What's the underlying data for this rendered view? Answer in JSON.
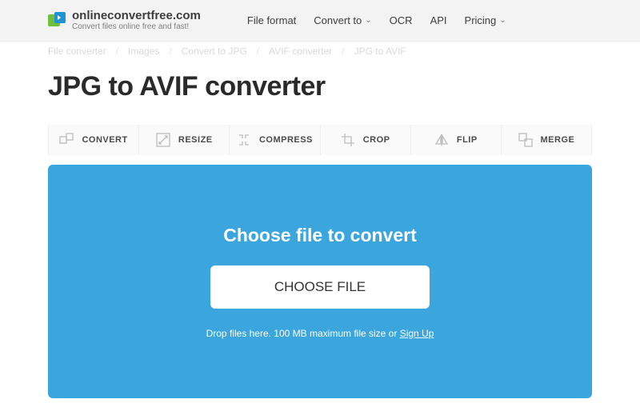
{
  "logo": {
    "title": "onlineconvertfree.com",
    "subtitle": "Convert files online free and fast!"
  },
  "nav": {
    "file_format": "File format",
    "convert_to": "Convert to",
    "ocr": "OCR",
    "api": "API",
    "pricing": "Pricing"
  },
  "breadcrumb": {
    "i0": "File converter",
    "i1": "Images",
    "i2": "Convert to JPG",
    "i3": "AVIF converter",
    "i4": "JPG to AVIF"
  },
  "page_title": "JPG to AVIF converter",
  "tools": {
    "convert": "CONVERT",
    "resize": "RESIZE",
    "compress": "COMPRESS",
    "crop": "CROP",
    "flip": "FLIP",
    "merge": "MERGE"
  },
  "drop": {
    "title": "Choose file to convert",
    "button": "CHOOSE FILE",
    "hint_pre": "Drop files here. 100 MB maximum file size or ",
    "hint_link": "Sign Up"
  }
}
